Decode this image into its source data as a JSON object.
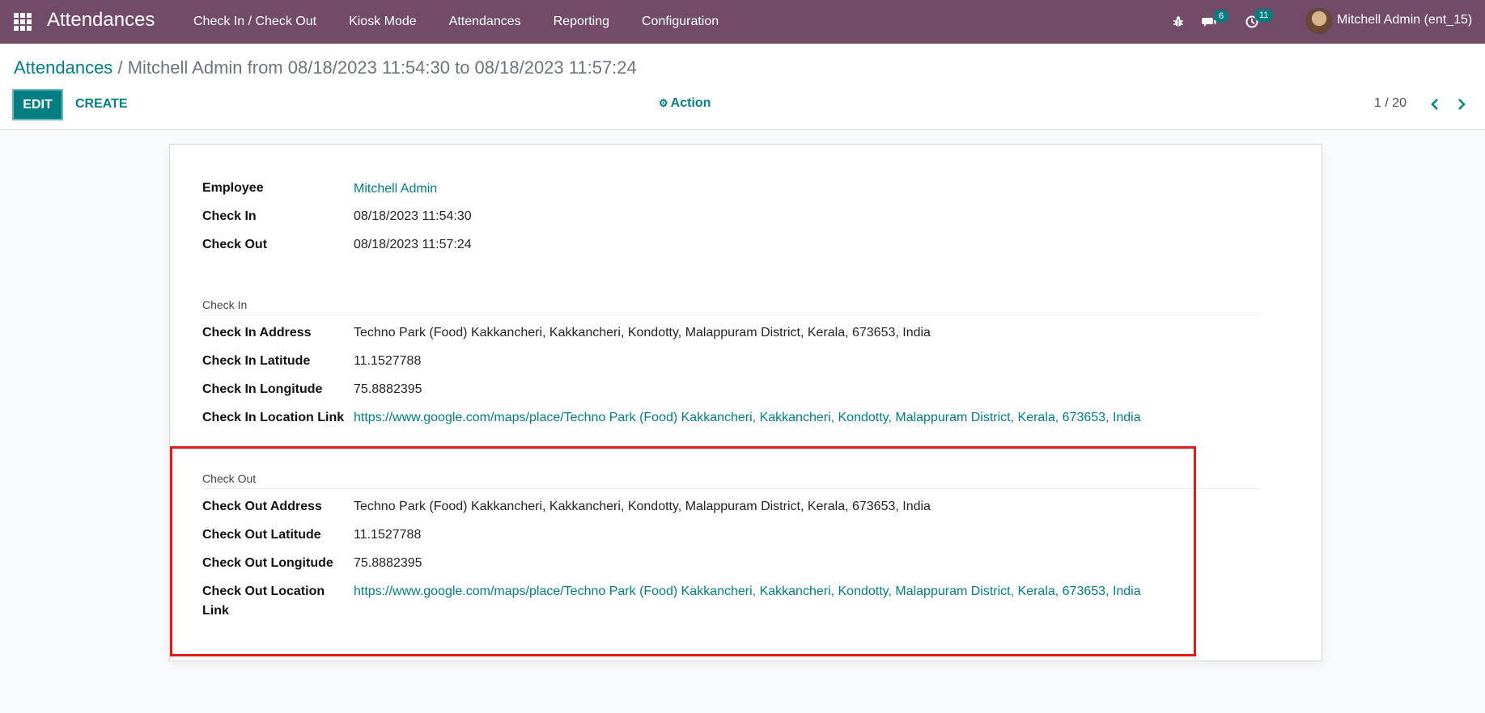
{
  "navbar": {
    "app_title": "Attendances",
    "menu": [
      "Check In / Check Out",
      "Kiosk Mode",
      "Attendances",
      "Reporting",
      "Configuration"
    ],
    "messages_badge": "6",
    "activities_badge": "11",
    "user_name": "Mitchell Admin (ent_15)",
    "icons": [
      "apps-grid-icon",
      "bug-icon",
      "chat-icon",
      "clock-icon",
      "avatar"
    ]
  },
  "control_panel": {
    "breadcrumb_root": "Attendances",
    "breadcrumb_sep": "/",
    "breadcrumb_current": "Mitchell Admin from 08/18/2023 11:54:30 to 08/18/2023 11:57:24",
    "edit_label": "EDIT",
    "create_label": "CREATE",
    "action_label": "Action",
    "pager": "1 / 20"
  },
  "form": {
    "employee_label": "Employee",
    "employee_value": "Mitchell Admin",
    "check_in_label": "Check In",
    "check_in_value": "08/18/2023 11:54:30",
    "check_out_label": "Check Out",
    "check_out_value": "08/18/2023 11:57:24",
    "check_in_section": {
      "title": "Check In",
      "address_label": "Check In Address",
      "address_value": "Techno Park (Food) Kakkancheri, Kakkancheri, Kondotty, Malappuram District, Kerala, 673653, India",
      "latitude_label": "Check In Latitude",
      "latitude_value": "11.1527788",
      "longitude_label": "Check In Longitude",
      "longitude_value": "75.8882395",
      "link_label": "Check In Location Link",
      "link_value": "https://www.google.com/maps/place/Techno Park (Food) Kakkancheri, Kakkancheri, Kondotty, Malappuram District, Kerala, 673653, India"
    },
    "check_out_section": {
      "title": "Check Out",
      "address_label": "Check Out Address",
      "address_value": "Techno Park (Food) Kakkancheri, Kakkancheri, Kondotty, Malappuram District, Kerala, 673653, India",
      "latitude_label": "Check Out Latitude",
      "latitude_value": "11.1527788",
      "longitude_label": "Check Out Longitude",
      "longitude_value": "75.8882395",
      "link_label_line1": "Check Out Location",
      "link_label_line2": "Link",
      "link_value": "https://www.google.com/maps/place/Techno Park (Food) Kakkancheri, Kakkancheri, Kondotty, Malappuram District, Kerala, 673653, India"
    }
  },
  "colors": {
    "navbar": "#714b67",
    "primary": "#017e84",
    "highlight": "#e01b1b"
  }
}
